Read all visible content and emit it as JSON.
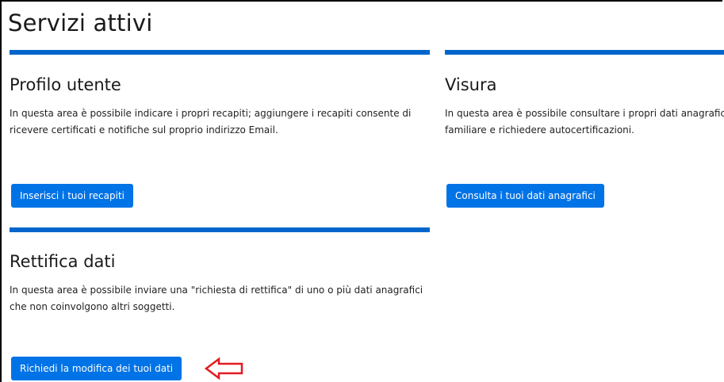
{
  "page": {
    "title": "Servizi attivi"
  },
  "cards": [
    {
      "title": "Profilo utente",
      "text_lines": [
        "In questa area è possibile indicare i propri recapiti; aggiungere i recapiti consente di",
        "ricevere certificati e notifiche sul proprio indirizzo Email."
      ],
      "button": "Inserisci i tuoi recapiti"
    },
    {
      "title": "Visura",
      "text_lines": [
        "In questa area è possibile consultare i propri dati anagrafic",
        "familiare e richiedere autocertificazioni."
      ],
      "button": "Consulta i tuoi dati anagrafici"
    },
    {
      "title": "Rettifica dati",
      "text_lines": [
        "In questa area è possibile inviare una \"richiesta di rettifica\" di uno o più dati anagrafici",
        "che non coinvolgono altri soggetti."
      ],
      "button": "Richiedi la modifica dei tuoi dati"
    }
  ],
  "annotation": {
    "icon": "left-arrow-outline-icon",
    "color": "#e31b23"
  },
  "colors": {
    "accent_bar": "#0066cc",
    "button": "#0073e6"
  }
}
